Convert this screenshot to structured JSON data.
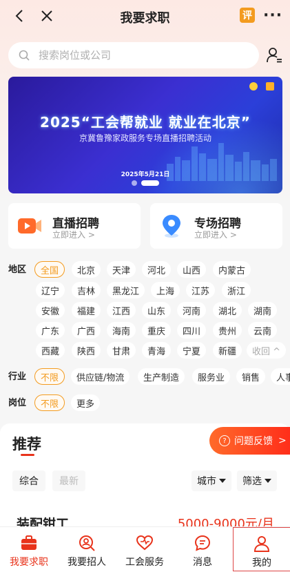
{
  "header": {
    "title": "我要求职",
    "review_badge": "评",
    "more": "···"
  },
  "search": {
    "placeholder": "搜索岗位或公司"
  },
  "banner": {
    "title": "2025“工会帮就业 就业在北京”",
    "subtitle": "京冀鲁豫家政服务专场直播招聘活动",
    "date": "2025年5月21日"
  },
  "quick_cards": [
    {
      "title": "直播招聘",
      "sub": "立即进入 >"
    },
    {
      "title": "专场招聘",
      "sub": "立即进入 >"
    }
  ],
  "filters": {
    "region_label": "地区",
    "regions": [
      "全国",
      "北京",
      "天津",
      "河北",
      "山西",
      "内蒙古",
      "辽宁",
      "吉林",
      "黑龙江",
      "上海",
      "江苏",
      "浙江",
      "安徽",
      "福建",
      "江西",
      "山东",
      "河南",
      "湖北",
      "湖南",
      "广东",
      "广西",
      "海南",
      "重庆",
      "四川",
      "贵州",
      "云南",
      "西藏",
      "陕西",
      "甘肃",
      "青海",
      "宁夏",
      "新疆"
    ],
    "collapse": "收回 ^",
    "industry_label": "行业",
    "industries": [
      "不限",
      "供应链/物流",
      "生产制造",
      "服务业",
      "销售",
      "人事"
    ],
    "position_label": "岗位",
    "positions": [
      "不限",
      "更多"
    ]
  },
  "recommend": {
    "title": "推荐",
    "feedback": "问题反馈",
    "tabs": [
      "综合",
      "最新"
    ],
    "city": "城市",
    "filter": "筛选"
  },
  "job": {
    "title": "装配钳工",
    "salary": "5000-9000元/月"
  },
  "bottom_nav": [
    {
      "label": "我要求职",
      "icon": "briefcase-icon"
    },
    {
      "label": "我要招人",
      "icon": "search-person-icon"
    },
    {
      "label": "工会服务",
      "icon": "heart-icon"
    },
    {
      "label": "消息",
      "icon": "message-icon"
    },
    {
      "label": "我的",
      "icon": "profile-icon"
    }
  ],
  "colors": {
    "accent_red": "#e8331b",
    "accent_orange": "#f39b1f",
    "banner_blue": "#2b3fd9"
  }
}
